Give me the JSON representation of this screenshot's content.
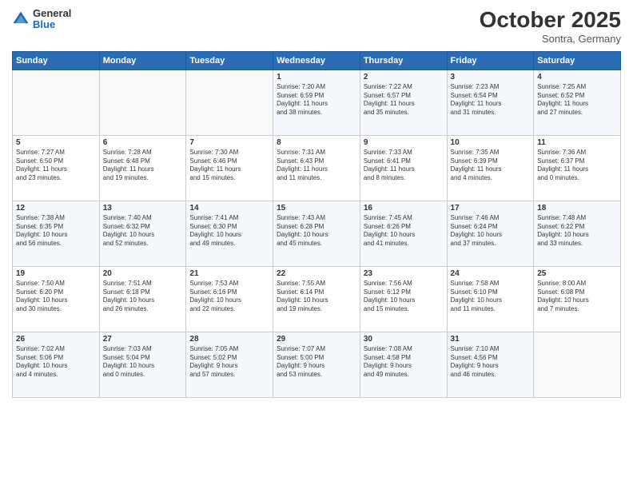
{
  "header": {
    "logo_general": "General",
    "logo_blue": "Blue",
    "month": "October 2025",
    "location": "Sontra, Germany"
  },
  "days_of_week": [
    "Sunday",
    "Monday",
    "Tuesday",
    "Wednesday",
    "Thursday",
    "Friday",
    "Saturday"
  ],
  "weeks": [
    [
      {
        "num": "",
        "info": ""
      },
      {
        "num": "",
        "info": ""
      },
      {
        "num": "",
        "info": ""
      },
      {
        "num": "1",
        "info": "Sunrise: 7:20 AM\nSunset: 6:59 PM\nDaylight: 11 hours\nand 38 minutes."
      },
      {
        "num": "2",
        "info": "Sunrise: 7:22 AM\nSunset: 6:57 PM\nDaylight: 11 hours\nand 35 minutes."
      },
      {
        "num": "3",
        "info": "Sunrise: 7:23 AM\nSunset: 6:54 PM\nDaylight: 11 hours\nand 31 minutes."
      },
      {
        "num": "4",
        "info": "Sunrise: 7:25 AM\nSunset: 6:52 PM\nDaylight: 11 hours\nand 27 minutes."
      }
    ],
    [
      {
        "num": "5",
        "info": "Sunrise: 7:27 AM\nSunset: 6:50 PM\nDaylight: 11 hours\nand 23 minutes."
      },
      {
        "num": "6",
        "info": "Sunrise: 7:28 AM\nSunset: 6:48 PM\nDaylight: 11 hours\nand 19 minutes."
      },
      {
        "num": "7",
        "info": "Sunrise: 7:30 AM\nSunset: 6:46 PM\nDaylight: 11 hours\nand 15 minutes."
      },
      {
        "num": "8",
        "info": "Sunrise: 7:31 AM\nSunset: 6:43 PM\nDaylight: 11 hours\nand 11 minutes."
      },
      {
        "num": "9",
        "info": "Sunrise: 7:33 AM\nSunset: 6:41 PM\nDaylight: 11 hours\nand 8 minutes."
      },
      {
        "num": "10",
        "info": "Sunrise: 7:35 AM\nSunset: 6:39 PM\nDaylight: 11 hours\nand 4 minutes."
      },
      {
        "num": "11",
        "info": "Sunrise: 7:36 AM\nSunset: 6:37 PM\nDaylight: 11 hours\nand 0 minutes."
      }
    ],
    [
      {
        "num": "12",
        "info": "Sunrise: 7:38 AM\nSunset: 6:35 PM\nDaylight: 10 hours\nand 56 minutes."
      },
      {
        "num": "13",
        "info": "Sunrise: 7:40 AM\nSunset: 6:32 PM\nDaylight: 10 hours\nand 52 minutes."
      },
      {
        "num": "14",
        "info": "Sunrise: 7:41 AM\nSunset: 6:30 PM\nDaylight: 10 hours\nand 49 minutes."
      },
      {
        "num": "15",
        "info": "Sunrise: 7:43 AM\nSunset: 6:28 PM\nDaylight: 10 hours\nand 45 minutes."
      },
      {
        "num": "16",
        "info": "Sunrise: 7:45 AM\nSunset: 6:26 PM\nDaylight: 10 hours\nand 41 minutes."
      },
      {
        "num": "17",
        "info": "Sunrise: 7:46 AM\nSunset: 6:24 PM\nDaylight: 10 hours\nand 37 minutes."
      },
      {
        "num": "18",
        "info": "Sunrise: 7:48 AM\nSunset: 6:22 PM\nDaylight: 10 hours\nand 33 minutes."
      }
    ],
    [
      {
        "num": "19",
        "info": "Sunrise: 7:50 AM\nSunset: 6:20 PM\nDaylight: 10 hours\nand 30 minutes."
      },
      {
        "num": "20",
        "info": "Sunrise: 7:51 AM\nSunset: 6:18 PM\nDaylight: 10 hours\nand 26 minutes."
      },
      {
        "num": "21",
        "info": "Sunrise: 7:53 AM\nSunset: 6:16 PM\nDaylight: 10 hours\nand 22 minutes."
      },
      {
        "num": "22",
        "info": "Sunrise: 7:55 AM\nSunset: 6:14 PM\nDaylight: 10 hours\nand 19 minutes."
      },
      {
        "num": "23",
        "info": "Sunrise: 7:56 AM\nSunset: 6:12 PM\nDaylight: 10 hours\nand 15 minutes."
      },
      {
        "num": "24",
        "info": "Sunrise: 7:58 AM\nSunset: 6:10 PM\nDaylight: 10 hours\nand 11 minutes."
      },
      {
        "num": "25",
        "info": "Sunrise: 8:00 AM\nSunset: 6:08 PM\nDaylight: 10 hours\nand 7 minutes."
      }
    ],
    [
      {
        "num": "26",
        "info": "Sunrise: 7:02 AM\nSunset: 5:06 PM\nDaylight: 10 hours\nand 4 minutes."
      },
      {
        "num": "27",
        "info": "Sunrise: 7:03 AM\nSunset: 5:04 PM\nDaylight: 10 hours\nand 0 minutes."
      },
      {
        "num": "28",
        "info": "Sunrise: 7:05 AM\nSunset: 5:02 PM\nDaylight: 9 hours\nand 57 minutes."
      },
      {
        "num": "29",
        "info": "Sunrise: 7:07 AM\nSunset: 5:00 PM\nDaylight: 9 hours\nand 53 minutes."
      },
      {
        "num": "30",
        "info": "Sunrise: 7:08 AM\nSunset: 4:58 PM\nDaylight: 9 hours\nand 49 minutes."
      },
      {
        "num": "31",
        "info": "Sunrise: 7:10 AM\nSunset: 4:56 PM\nDaylight: 9 hours\nand 46 minutes."
      },
      {
        "num": "",
        "info": ""
      }
    ]
  ]
}
